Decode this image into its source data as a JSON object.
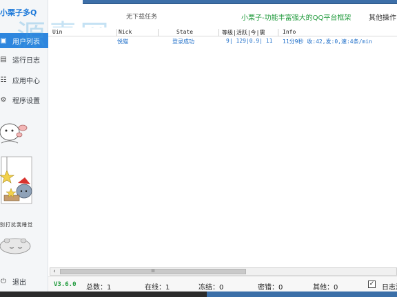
{
  "sidebar": {
    "logo": "小栗子多Q",
    "items": [
      {
        "label": "用户列表",
        "icon": "user-list-icon"
      },
      {
        "label": "运行日志",
        "icon": "log-icon"
      },
      {
        "label": "应用中心",
        "icon": "apps-icon"
      },
      {
        "label": "程序设置",
        "icon": "settings-icon"
      }
    ],
    "exit_label": "退出",
    "sticker_text": "别打扰我睡觉"
  },
  "watermark": "源素网",
  "header": {
    "task": "无下载任务",
    "slogan": "小栗子-功能丰富强大的QQ平台框架",
    "other_ops": "其他操作"
  },
  "table": {
    "columns": [
      "Uin",
      "Nick",
      "State",
      "等级|活跃|今|需",
      "Info"
    ],
    "rows": [
      {
        "uin": "",
        "nick": "悦猫",
        "state": "登录成功",
        "level": "9| 129|0.9| 11",
        "info": "11分9秒 收:42,发:0,速:4条/min"
      }
    ]
  },
  "scrollbar": {
    "thumb_glyph": "III"
  },
  "status": {
    "version": "V3.6.0",
    "total": "总数：1",
    "online": "在线：1",
    "frozen": "冻结：0",
    "wrong_pwd": "密错：0",
    "other": "其他：0",
    "log_label": "日志滚",
    "log_checked": true
  },
  "colors": {
    "accent": "#2e86de",
    "slogan_green": "#1f9a3b",
    "link_blue": "#1f6fc9"
  }
}
